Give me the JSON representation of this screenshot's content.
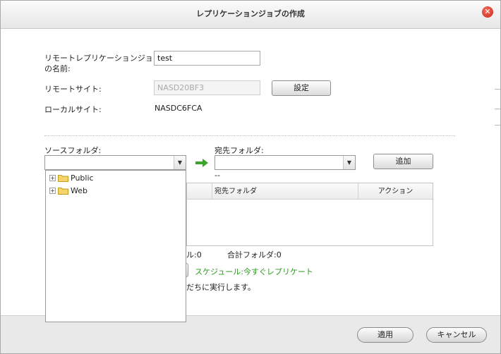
{
  "dialog": {
    "title": "レプリケーションジョブの作成"
  },
  "form": {
    "job_name_label": "リモートレプリケーションジョブ\nの名前:",
    "job_name_value": "test",
    "remote_site_label": "リモートサイト:",
    "remote_site_value": "NASD20BF3",
    "settings_button": "設定",
    "local_site_label": "ローカルサイト:",
    "local_site_value": "NASDC6FCA"
  },
  "folders": {
    "source_label": "ソースフォルダ:",
    "source_value": "",
    "dest_label": "宛先フォルダ:",
    "dest_value": "",
    "dest_path_text": "--",
    "add_button": "追加",
    "source_tree": [
      {
        "label": "Public"
      },
      {
        "label": "Web"
      }
    ]
  },
  "table": {
    "columns": [
      "",
      "宛先フォルダ",
      "アクション"
    ]
  },
  "summary": {
    "total_files_fragment": "ル:0",
    "total_folders": "合計フォルダ:0",
    "schedule_text": "スケジュール:今すぐレプリケート",
    "run_text_fragment": "だちに実行します。"
  },
  "footer": {
    "apply_button": "適用",
    "cancel_button": "キャンセル"
  },
  "colors": {
    "accent_green": "#2a9a1c",
    "close_red": "#d93a2b"
  }
}
